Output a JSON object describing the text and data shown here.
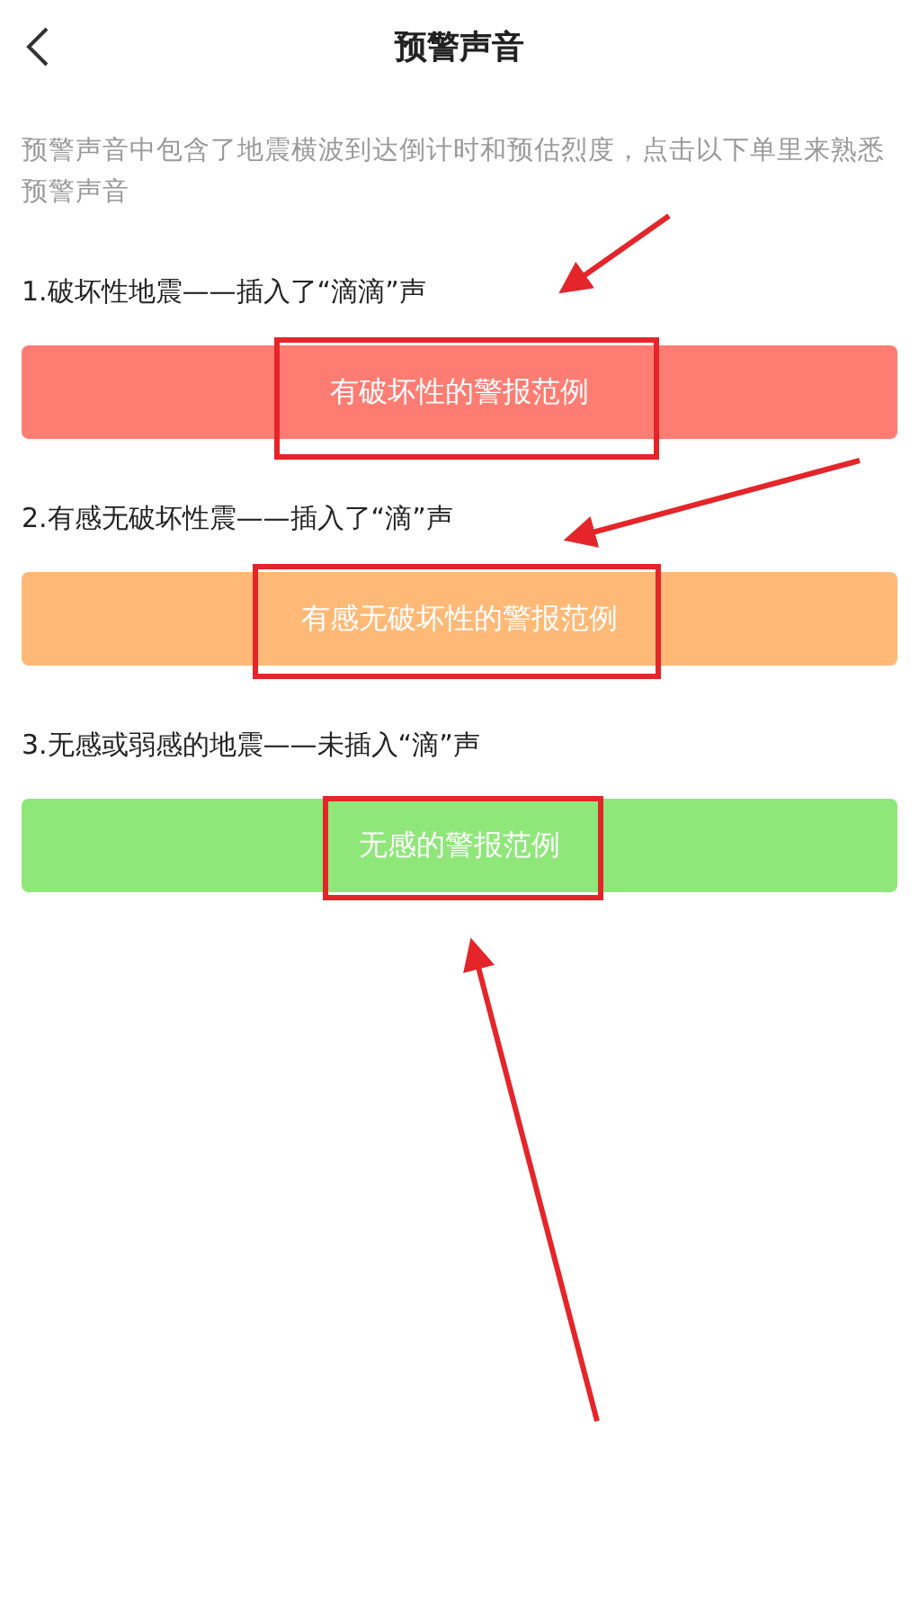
{
  "header": {
    "title": "预警声音"
  },
  "description": "预警声音中包含了地震横波到达倒计时和预估烈度，点击以下单里来熟悉预警声音",
  "sections": [
    {
      "label": "1.破坏性地震——插入了“滴滴”声",
      "button": "有破坏性的警报范例",
      "color": "#ff7c73"
    },
    {
      "label": "2.有感无破坏性震——插入了“滴”声",
      "button": "有感无破坏性的警报范例",
      "color": "#ffb976"
    },
    {
      "label": "3.无感或弱感的地震——未插入“滴”声",
      "button": "无感的警报范例",
      "color": "#8fe77a"
    }
  ]
}
